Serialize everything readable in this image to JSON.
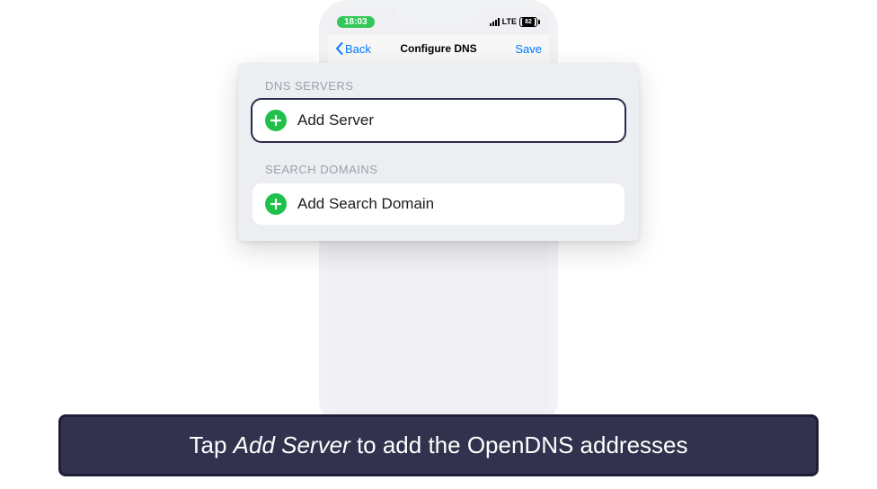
{
  "status": {
    "time": "18:03",
    "network": "LTE",
    "battery": "82"
  },
  "nav": {
    "back": "Back",
    "title": "Configure DNS",
    "save": "Save"
  },
  "sections": {
    "dns_servers_label": "DNS SERVERS",
    "add_server": "Add Server",
    "search_domains_label": "SEARCH DOMAINS",
    "add_search_domain": "Add Search Domain"
  },
  "caption": {
    "prefix": "Tap ",
    "emphasis": "Add Server",
    "suffix": " to add the OpenDNS addresses"
  }
}
